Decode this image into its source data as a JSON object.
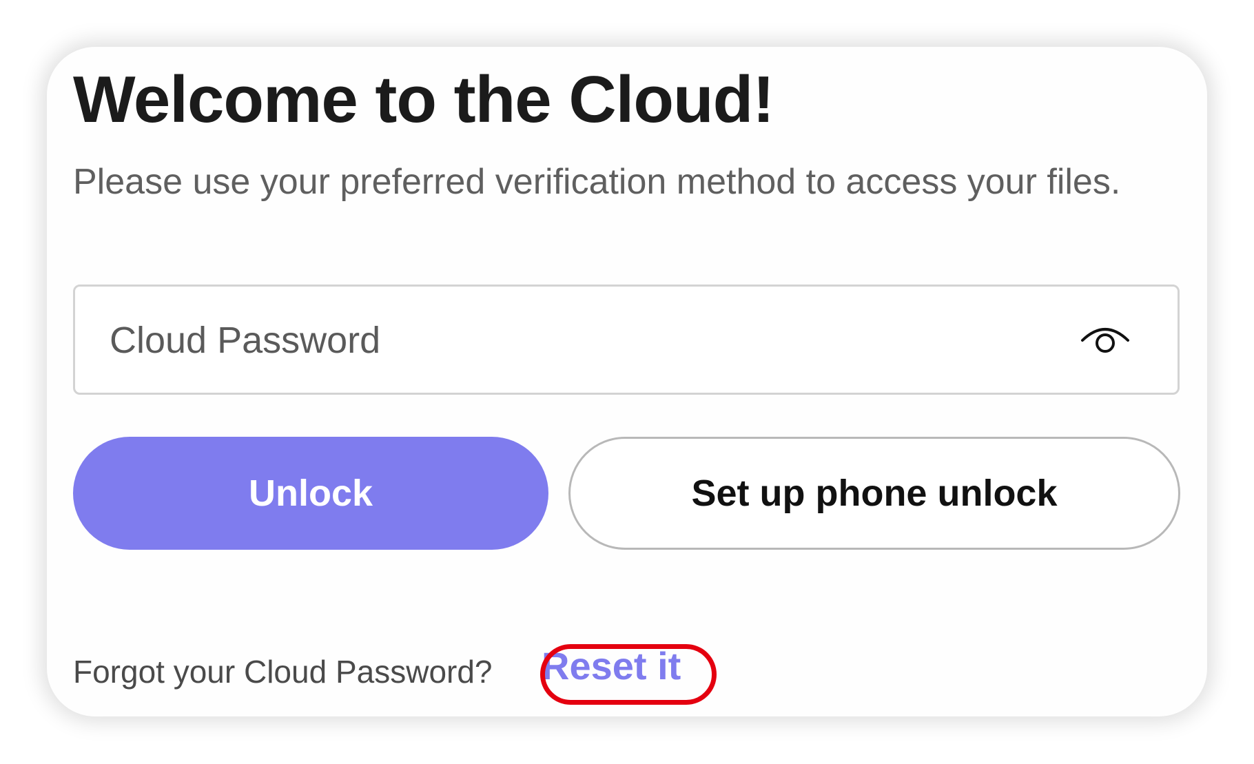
{
  "header": {
    "title": "Welcome to the Cloud!",
    "subtitle": "Please use your preferred verification method to access your files."
  },
  "password": {
    "placeholder": "Cloud Password",
    "value": "",
    "toggle_icon": "eye-icon"
  },
  "actions": {
    "unlock_label": "Unlock",
    "phone_unlock_label": "Set up phone unlock"
  },
  "footer": {
    "forgot_text": "Forgot your Cloud Password?",
    "reset_label": "Reset it"
  },
  "colors": {
    "accent": "#7f7cee",
    "highlight": "#e4000f",
    "title": "#1b1b1b",
    "muted_text": "#5f5f5f"
  }
}
